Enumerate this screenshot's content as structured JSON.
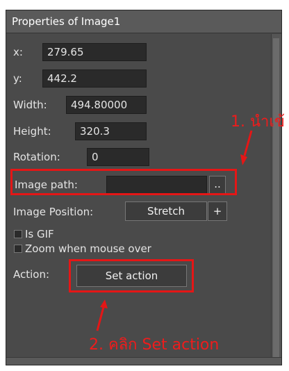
{
  "panel": {
    "title": "Properties of Image1",
    "x_label": "x:",
    "x_value": "279.65",
    "y_label": "y:",
    "y_value": "442.2",
    "width_label": "Width:",
    "width_value": "494.80000",
    "height_label": "Height:",
    "height_value": "320.3",
    "rotation_label": "Rotation:",
    "rotation_value": "0",
    "image_path_label": "Image path:",
    "image_path_value": "",
    "browse_label": "..",
    "image_position_label": "Image Position:",
    "image_position_value": "Stretch",
    "add_label": "+",
    "is_gif_label": "Is GIF",
    "zoom_label": "Zoom when mouse over",
    "action_label": "Action:",
    "set_action_label": "Set action"
  },
  "annotations": {
    "step1": "1. นำเข้",
    "step2": "2. คลิก Set action",
    "color": "#e51616"
  }
}
